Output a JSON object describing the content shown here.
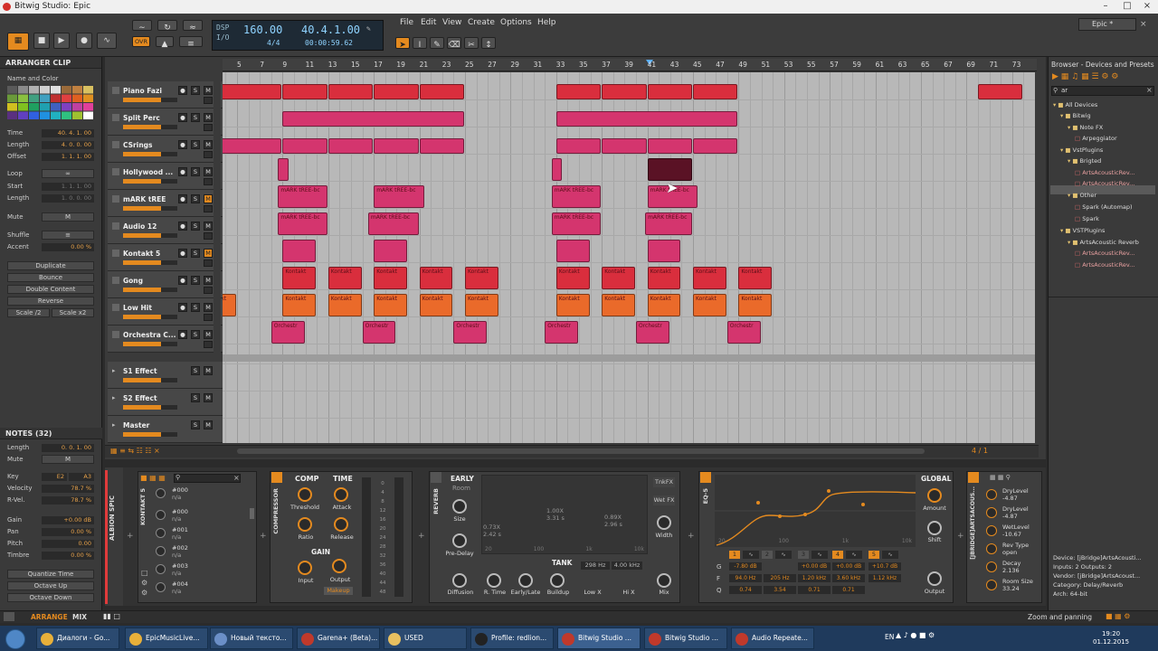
{
  "window": {
    "title": "Bitwig Studio: Epic",
    "tab": "Epic *"
  },
  "menu": [
    "File",
    "Edit",
    "View",
    "Create",
    "Options",
    "Help"
  ],
  "transport": {
    "tempo": "160.00",
    "position": "40.4.1.00",
    "signature": "4/4",
    "time": "00:00:59.62",
    "dsp_label": "DSP",
    "io_label": "I/O",
    "ovr_label": "OVR"
  },
  "left_panel": {
    "section": "ARRANGER CLIP",
    "name_color": "Name and Color",
    "props": [
      {
        "label": "Time",
        "value": "40. 4. 1. 00"
      },
      {
        "label": "Length",
        "value": "4. 0. 0. 00"
      },
      {
        "label": "Offset",
        "value": "1. 1. 1. 00"
      }
    ],
    "loop": {
      "label": "Loop",
      "start_label": "Start",
      "start": "1. 1. 1. 00",
      "length_label": "Length",
      "length": "1. 0. 0. 00"
    },
    "mute_label": "Mute",
    "mute_value": "M",
    "shuffle_label": "Shuffle",
    "accent_label": "Accent",
    "accent_value": "0.00 %",
    "buttons": [
      "Duplicate",
      "Bounce",
      "Double Content",
      "Reverse"
    ],
    "scale_half": "Scale /2",
    "scale_double": "Scale x2",
    "notes_section": "NOTES (32)",
    "notes_length_label": "Length",
    "notes_length": "0. 0. 1. 00",
    "notes_mute_label": "Mute",
    "notes_mute": "M",
    "note_props": [
      {
        "label": "Key",
        "value": "E2",
        "value2": "A3"
      },
      {
        "label": "Velocity",
        "value": "78.7 %"
      },
      {
        "label": "R-Vel.",
        "value": "78.7 %"
      }
    ],
    "note_props2": [
      {
        "label": "Gain",
        "value": "+0.00 dB"
      },
      {
        "label": "Pan",
        "value": "0.00 %"
      },
      {
        "label": "Pitch",
        "value": "0.00"
      },
      {
        "label": "Timbre",
        "value": "0.00 %"
      }
    ],
    "note_buttons": [
      "Quantize Time",
      "Octave Up",
      "Octave Down"
    ]
  },
  "ruler": [
    "5",
    "7",
    "9",
    "11",
    "13",
    "15",
    "17",
    "19",
    "21",
    "23",
    "25",
    "27",
    "29",
    "31",
    "33",
    "35",
    "37",
    "39",
    "41",
    "43",
    "45",
    "47",
    "49",
    "51",
    "53",
    "55",
    "57",
    "59",
    "61",
    "63",
    "65",
    "67",
    "69",
    "71",
    "73"
  ],
  "tracks": [
    {
      "name": "Piano Fazi",
      "armed": false
    },
    {
      "name": "Split Perc",
      "armed": false
    },
    {
      "name": "CSrings",
      "armed": false
    },
    {
      "name": "Hollywood ...",
      "armed": false
    },
    {
      "name": "mARK tREE",
      "armed": true
    },
    {
      "name": "Audio 12",
      "armed": false
    },
    {
      "name": "Kontakt 5",
      "armed": true
    },
    {
      "name": "Gong",
      "armed": false
    },
    {
      "name": "Low Hit",
      "armed": false
    },
    {
      "name": "Orchestra C...",
      "armed": false
    }
  ],
  "effect_tracks": [
    {
      "name": "S1 Effect"
    },
    {
      "name": "S2 Effect"
    },
    {
      "name": "Master"
    }
  ],
  "clip_labels": {
    "mark": "mARK tREE-bc",
    "kontakt": "Kontakt",
    "orch": "Orchestr"
  },
  "arranger_footer": {
    "zoom": "4 / 1"
  },
  "browser": {
    "title": "Browser - Devices and Presets",
    "search": "ar",
    "tree": [
      "All Devices",
      "Bitwig",
      "Note FX",
      "Arpeggiator",
      "VstPlugins",
      "Brigted",
      "ArtsAcousticRev...",
      "ArtsAcousticRev...",
      "Other",
      "Spark (Automap)",
      "Spark",
      "VSTPlugins",
      "ArtsAcoustic Reverb",
      "ArtsAcousticRev...",
      "ArtsAcousticRev..."
    ],
    "info": [
      "Device: [jBridge]ArtsAcousti...",
      "Inputs: 2   Outputs: 2",
      "Vendor: [jBridge]ArtsAcoust...",
      "Category: Delay/Reverb",
      "Arch: 64-bit"
    ]
  },
  "devices": {
    "track_label": "ALBION SPIC",
    "kontakt_label": "KONTAKT 5",
    "programs": [
      {
        "num": "#000",
        "val": "n/a"
      },
      {
        "num": "#000",
        "val": "n/a"
      },
      {
        "num": "#001",
        "val": "n/a"
      },
      {
        "num": "#002",
        "val": "n/a"
      },
      {
        "num": "#003",
        "val": "n/a"
      },
      {
        "num": "#004",
        "val": "n/a"
      }
    ],
    "compressor": {
      "label": "COMPRESSOR",
      "comp": "COMP",
      "time": "TIME",
      "threshold": "Threshold",
      "attack": "Attack",
      "ratio": "Ratio",
      "release": "Release",
      "gain": "GAIN",
      "input": "Input",
      "output": "Output",
      "makeup": "Makeup",
      "meter_scale": [
        "0",
        "4",
        "8",
        "12",
        "16",
        "20",
        "24",
        "28",
        "32",
        "36",
        "40",
        "44",
        "48"
      ]
    },
    "reverb": {
      "label": "REVERB",
      "early": "EARLY",
      "room": "Room",
      "size": "Size",
      "predelay": "Pre-Delay",
      "diffusion": "Diffusion",
      "tank": "TANK",
      "rtime": "R. Time",
      "earlylate": "Early/Late",
      "buildup": "Buildup",
      "lowx": "Low X",
      "hix": "Hi X",
      "mix": "Mix",
      "tnkfx": "TnkFX",
      "wetfx": "Wet FX",
      "width": "Width",
      "readouts": [
        "1.00X",
        "3.31 s",
        "0.73X",
        "2.42 s",
        "0.89X",
        "2.96 s"
      ],
      "freq1": "298 Hz",
      "freq2": "4.00 kHz",
      "axis": [
        "20",
        "100",
        "1k",
        "10k"
      ]
    },
    "eq": {
      "label": "EQ-5",
      "global": "GLOBAL",
      "amount": "Amount",
      "shift": "Shift",
      "output": "Output",
      "bands": [
        "1",
        "2",
        "3",
        "4",
        "5"
      ],
      "row_labels": [
        "G",
        "F",
        "Q"
      ],
      "gains": [
        "-7.80 dB",
        "+0.00 dB",
        "+0.00 dB",
        "+10.7 dB"
      ],
      "freqs": [
        "94.0 Hz",
        "205 Hz",
        "1.20 kHz",
        "3.60 kHz",
        "1.12 kHz"
      ],
      "qs": [
        "0.74",
        "3.54",
        "0.71",
        "0.71"
      ],
      "axis": [
        "20",
        "100",
        "1k",
        "10k"
      ]
    },
    "jbridge": {
      "label": "[JBRIDGE]ARTSACOUS...",
      "params": [
        {
          "name": "DryLevel",
          "val": "-4.87"
        },
        {
          "name": "DryLevel",
          "val": "-4.87"
        },
        {
          "name": "WetLevel",
          "val": "-10.67"
        },
        {
          "name": "Rev Type",
          "val": "open"
        },
        {
          "name": "Decay",
          "val": "2.136"
        },
        {
          "name": "Room Size",
          "val": "33.24"
        }
      ]
    }
  },
  "status": {
    "arrange": "ARRANGE",
    "mix": "MIX",
    "zoom": "Zoom and panning"
  },
  "taskbar": {
    "items": [
      "Диалоги - Go...",
      "EpicMusicLive...",
      "Новый тексто...",
      "Garena+ (Beta)...",
      "USED",
      "Profile: redlion...",
      "Bitwig Studio ...",
      "Bitwig Studio ...",
      "Audio Repeate..."
    ],
    "lang": "EN",
    "clock": "19:20",
    "date": "01.12.2015"
  }
}
